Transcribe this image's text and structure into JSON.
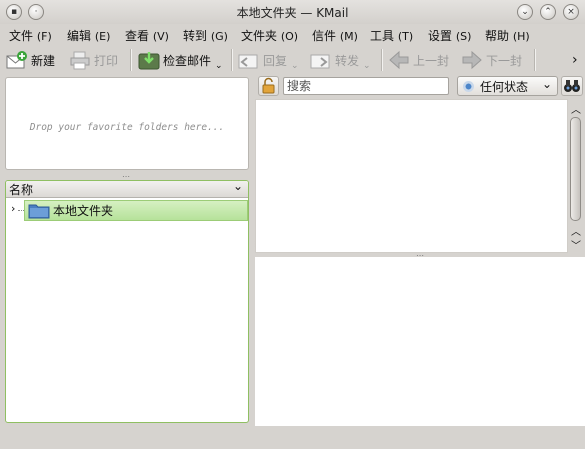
{
  "window": {
    "title": "本地文件夹 — KMail"
  },
  "menu": [
    {
      "label": "文件",
      "mn": "(F)"
    },
    {
      "label": "编辑",
      "mn": "(E)"
    },
    {
      "label": "查看",
      "mn": "(V)"
    },
    {
      "label": "转到",
      "mn": "(G)"
    },
    {
      "label": "文件夹",
      "mn": "(O)"
    },
    {
      "label": "信件",
      "mn": "(M)"
    },
    {
      "label": "工具",
      "mn": "(T)"
    },
    {
      "label": "设置",
      "mn": "(S)"
    },
    {
      "label": "帮助",
      "mn": "(H)"
    }
  ],
  "toolbar": {
    "new": "新建",
    "print": "打印",
    "check_mail": "检查邮件",
    "reply": "回复",
    "forward": "转发",
    "prev": "上一封",
    "next": "下一封",
    "more": "›"
  },
  "favorites": {
    "placeholder": "Drop your favorite folders here..."
  },
  "folder_tree": {
    "header": "名称",
    "items": [
      {
        "label": "本地文件夹",
        "expanded": false
      }
    ]
  },
  "search": {
    "placeholder": "搜索",
    "value": ""
  },
  "status_filter": {
    "selected": "任何状态"
  },
  "colors": {
    "accent_green": "#9ccc77",
    "folder_blue": "#4a7fc1"
  }
}
